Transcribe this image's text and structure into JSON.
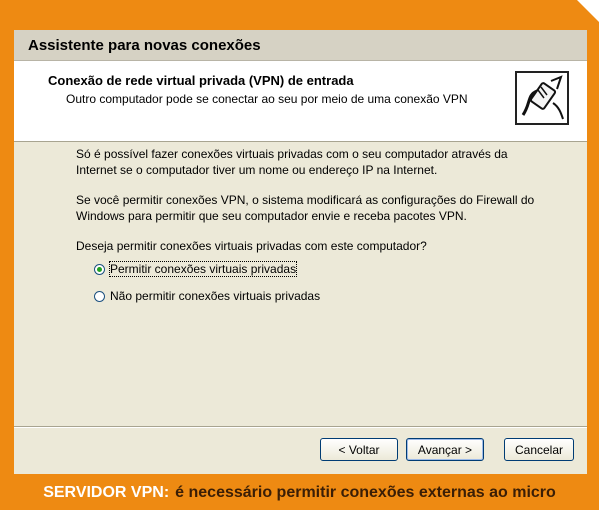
{
  "window": {
    "title": "Assistente para novas conexões"
  },
  "header": {
    "title": "Conexão de rede virtual privada (VPN) de entrada",
    "subtitle": "Outro computador pode se conectar ao seu por meio de uma conexão VPN",
    "icon": "network-cable-icon"
  },
  "body": {
    "paragraph1": [
      "Só é possível fazer conexões virtuais privadas com o seu computador através da",
      "Internet se o computador tiver um nome ou endereço IP na Internet."
    ],
    "paragraph2": [
      "Se você permitir conexões VPN, o sistema modificará as configurações do Firewall do",
      "Windows para permitir que seu computador envie e receba pacotes VPN."
    ],
    "question": "Deseja permitir conexões virtuais privadas com este computador?",
    "options": [
      {
        "label": "Permitir conexões virtuais privadas",
        "selected": true
      },
      {
        "label": "Não permitir conexões virtuais privadas",
        "selected": false
      }
    ]
  },
  "buttons": {
    "back": "< Voltar",
    "next": "Avançar >",
    "cancel": "Cancelar"
  },
  "caption": {
    "lead": "SERVIDOR VPN:",
    "rest": "é necessário permitir conexões externas ao micro"
  },
  "colors": {
    "frame": "#ee8a12",
    "dialog": "#ece9d8",
    "selected_radio": "#21a121"
  }
}
